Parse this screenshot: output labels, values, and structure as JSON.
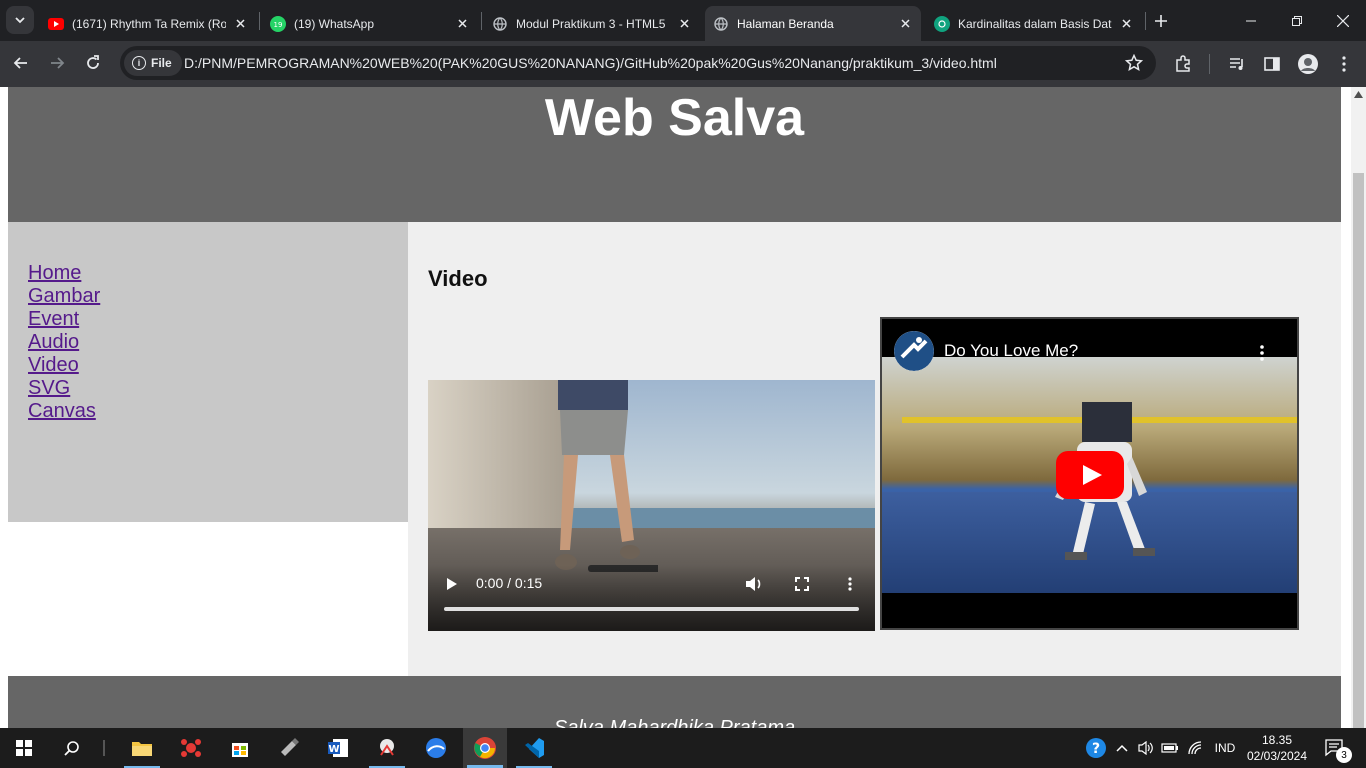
{
  "browser": {
    "tabs": [
      {
        "title": "(1671) Rhythm Ta Remix (Roc",
        "icon": "youtube-icon",
        "active": false
      },
      {
        "title": "(19) WhatsApp",
        "icon": "whatsapp-icon",
        "active": false
      },
      {
        "title": "Modul Praktikum 3 - HTML5",
        "icon": "globe-icon",
        "active": false
      },
      {
        "title": "Halaman Beranda",
        "icon": "globe-icon",
        "active": true
      },
      {
        "title": "Kardinalitas dalam Basis Dat",
        "icon": "chatgpt-icon",
        "active": false
      }
    ],
    "omnibox": {
      "chip_label": "File",
      "url": "D:/PNM/PEMROGRAMAN%20WEB%20(PAK%20GUS%20NANANG)/GitHub%20pak%20Gus%20Nanang/praktikum_3/video.html"
    }
  },
  "page": {
    "site_title": "Web Salva",
    "nav": [
      {
        "label": "Home"
      },
      {
        "label": "Gambar"
      },
      {
        "label": "Event"
      },
      {
        "label": "Audio"
      },
      {
        "label": "Video"
      },
      {
        "label": "SVG"
      },
      {
        "label": "Canvas"
      }
    ],
    "section_heading": "Video",
    "video_player": {
      "time": "0:00 / 0:15",
      "progress": 0
    },
    "youtube": {
      "title": "Do You Love Me?"
    },
    "footer_text": "Salva Mahardhika Pratama"
  },
  "taskbar": {
    "language": "IND",
    "time": "18.35",
    "date": "02/03/2024",
    "notifications": "3"
  },
  "colors": {
    "header_bg": "#666666",
    "sidebar_bg": "#c8c8c8",
    "main_bg": "#efefef",
    "link": "#551a8b",
    "youtube_red": "#ff0000"
  }
}
